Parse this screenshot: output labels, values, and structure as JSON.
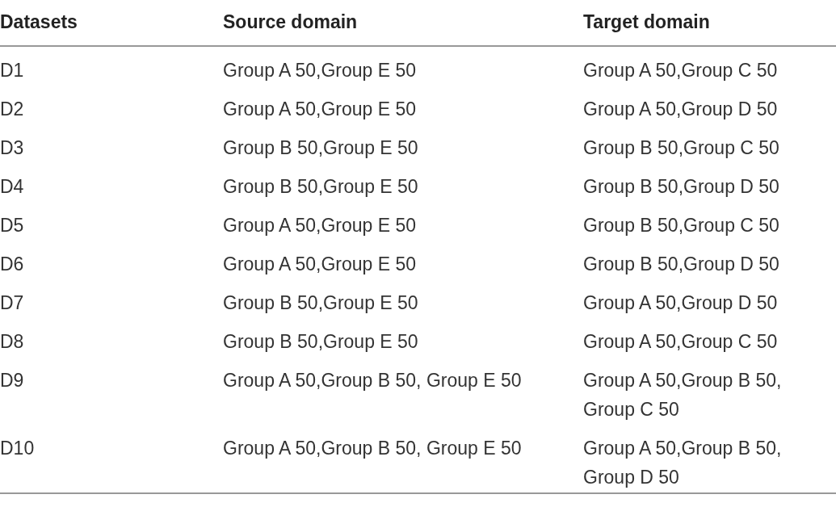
{
  "table": {
    "columns": [
      "Datasets",
      "Source domain",
      "Target domain"
    ],
    "rows": [
      [
        "D1",
        "Group A 50,Group E 50",
        "Group A 50,Group C 50"
      ],
      [
        "D2",
        "Group A 50,Group E 50",
        "Group A 50,Group D 50"
      ],
      [
        "D3",
        "Group B 50,Group E 50",
        "Group B 50,Group C 50"
      ],
      [
        "D4",
        "Group B 50,Group E 50",
        "Group B 50,Group D 50"
      ],
      [
        "D5",
        "Group A 50,Group E 50",
        "Group B 50,Group C 50"
      ],
      [
        "D6",
        "Group A 50,Group E 50",
        "Group B 50,Group D 50"
      ],
      [
        "D7",
        "Group B 50,Group E 50",
        "Group A 50,Group D 50"
      ],
      [
        "D8",
        "Group B 50,Group E 50",
        "Group A 50,Group C 50"
      ],
      [
        "D9",
        "Group A 50,Group B 50, Group E 50",
        "Group A 50,Group B 50, Group C 50"
      ],
      [
        "D10",
        "Group A 50,Group B 50, Group E 50",
        "Group A 50,Group B 50, Group D 50"
      ]
    ]
  }
}
